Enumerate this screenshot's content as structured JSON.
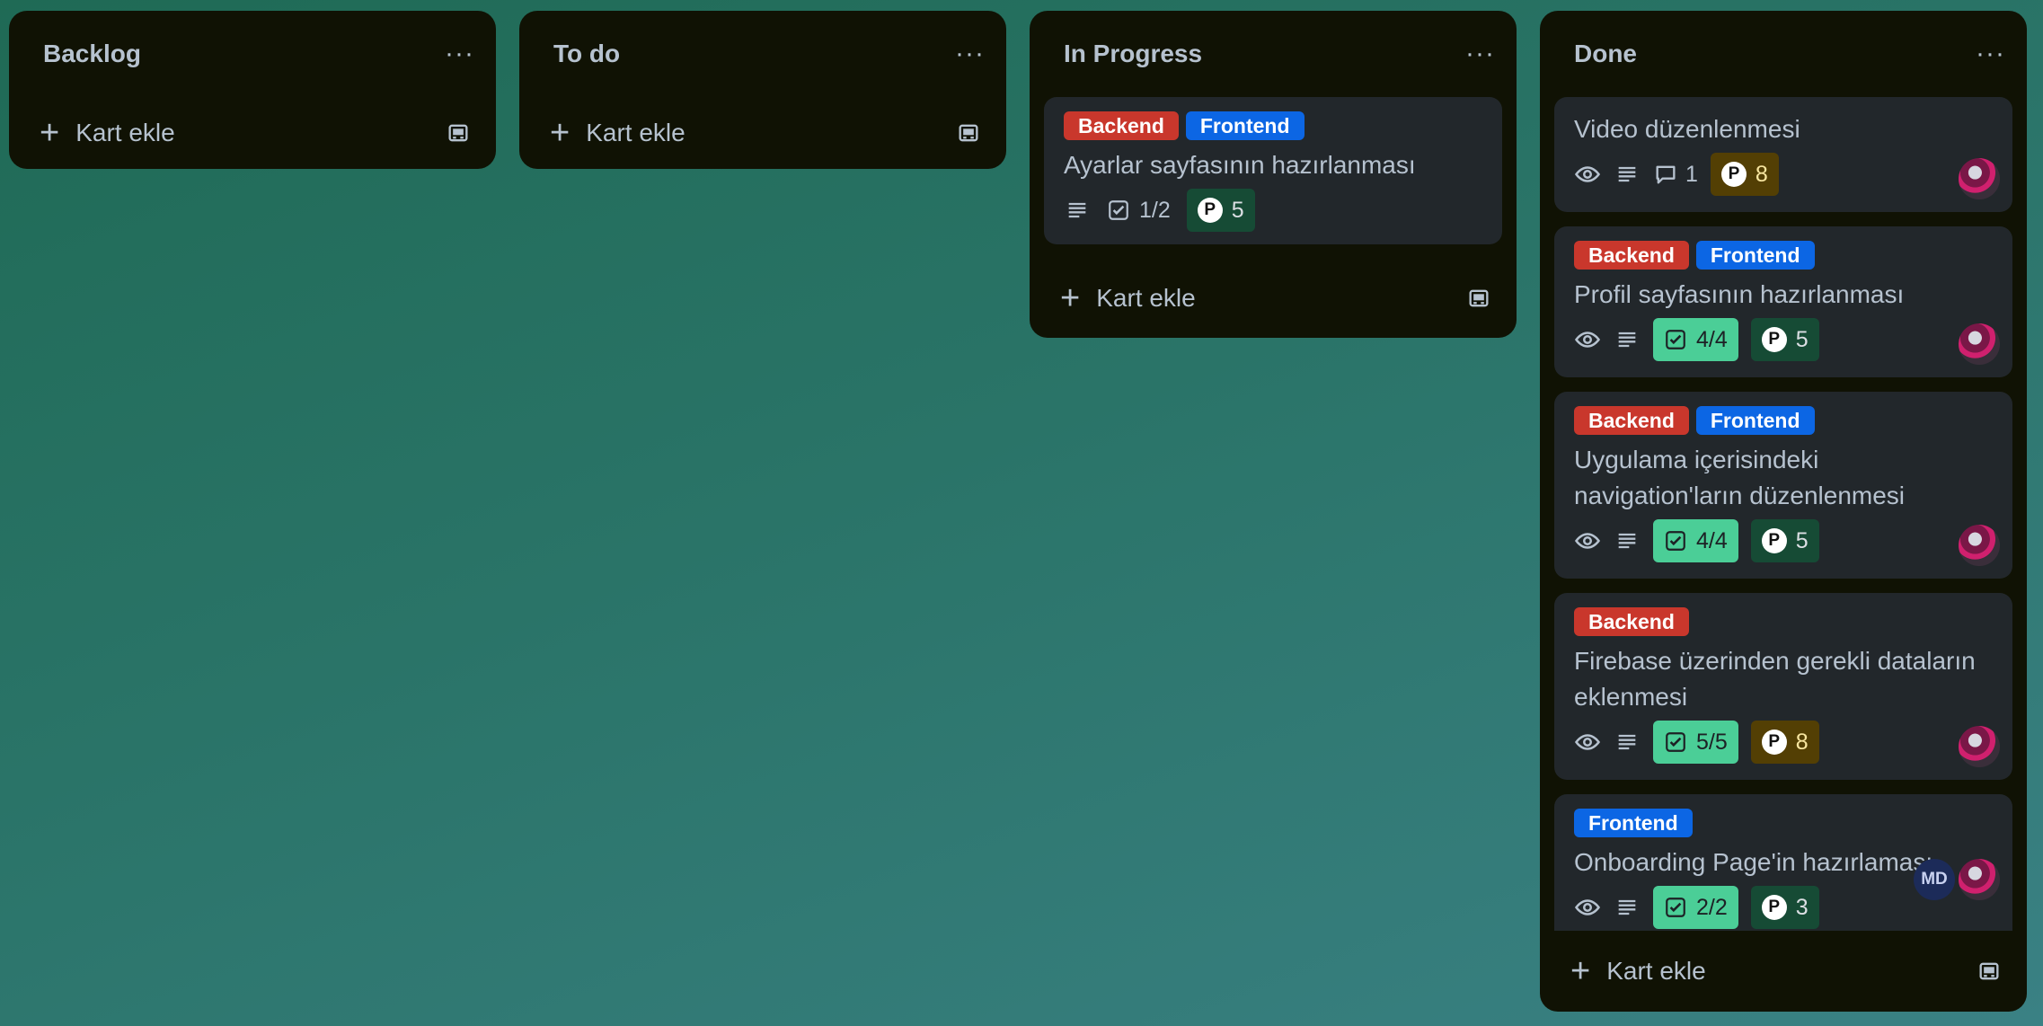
{
  "lists": [
    {
      "title": "Backlog",
      "menu": "···",
      "add_label": "Kart ekle"
    },
    {
      "title": "To do",
      "menu": "···",
      "add_label": "Kart ekle"
    },
    {
      "title": "In Progress",
      "menu": "···",
      "add_label": "Kart ekle"
    },
    {
      "title": "Done",
      "menu": "···",
      "add_label": "Kart ekle"
    }
  ],
  "labels": {
    "backend": "Backend",
    "frontend": "Frontend"
  },
  "in_progress_cards": [
    {
      "title": "Ayarlar sayfasının hazırlanması",
      "checklist": "1/2",
      "points": "5"
    }
  ],
  "done_cards": [
    {
      "title": "Video düzenlenmesi",
      "comments": "1",
      "points": "8"
    },
    {
      "title": "Profil sayfasının hazırlanması",
      "checklist": "4/4",
      "points": "5"
    },
    {
      "title": "Uygulama içerisindeki navigation'ların düzenlenmesi",
      "checklist": "4/4",
      "points": "5"
    },
    {
      "title": "Firebase üzerinden gerekli dataların eklenmesi",
      "checklist": "5/5",
      "points": "8"
    },
    {
      "title": "Onboarding Page'in hazırlaması",
      "checklist": "2/2",
      "points": "3",
      "member_initials": "MD"
    }
  ],
  "points_glyph": "P",
  "icons": [
    "eye-icon",
    "description-icon",
    "checklist-icon",
    "comment-icon",
    "plus-icon",
    "template-icon",
    "more-icon"
  ],
  "colors": {
    "label_red": "#c9372c",
    "label_blue": "#0c66e4",
    "check_done": "#4bce97",
    "points_green": "#164b35",
    "points_yellow": "#533f04"
  }
}
